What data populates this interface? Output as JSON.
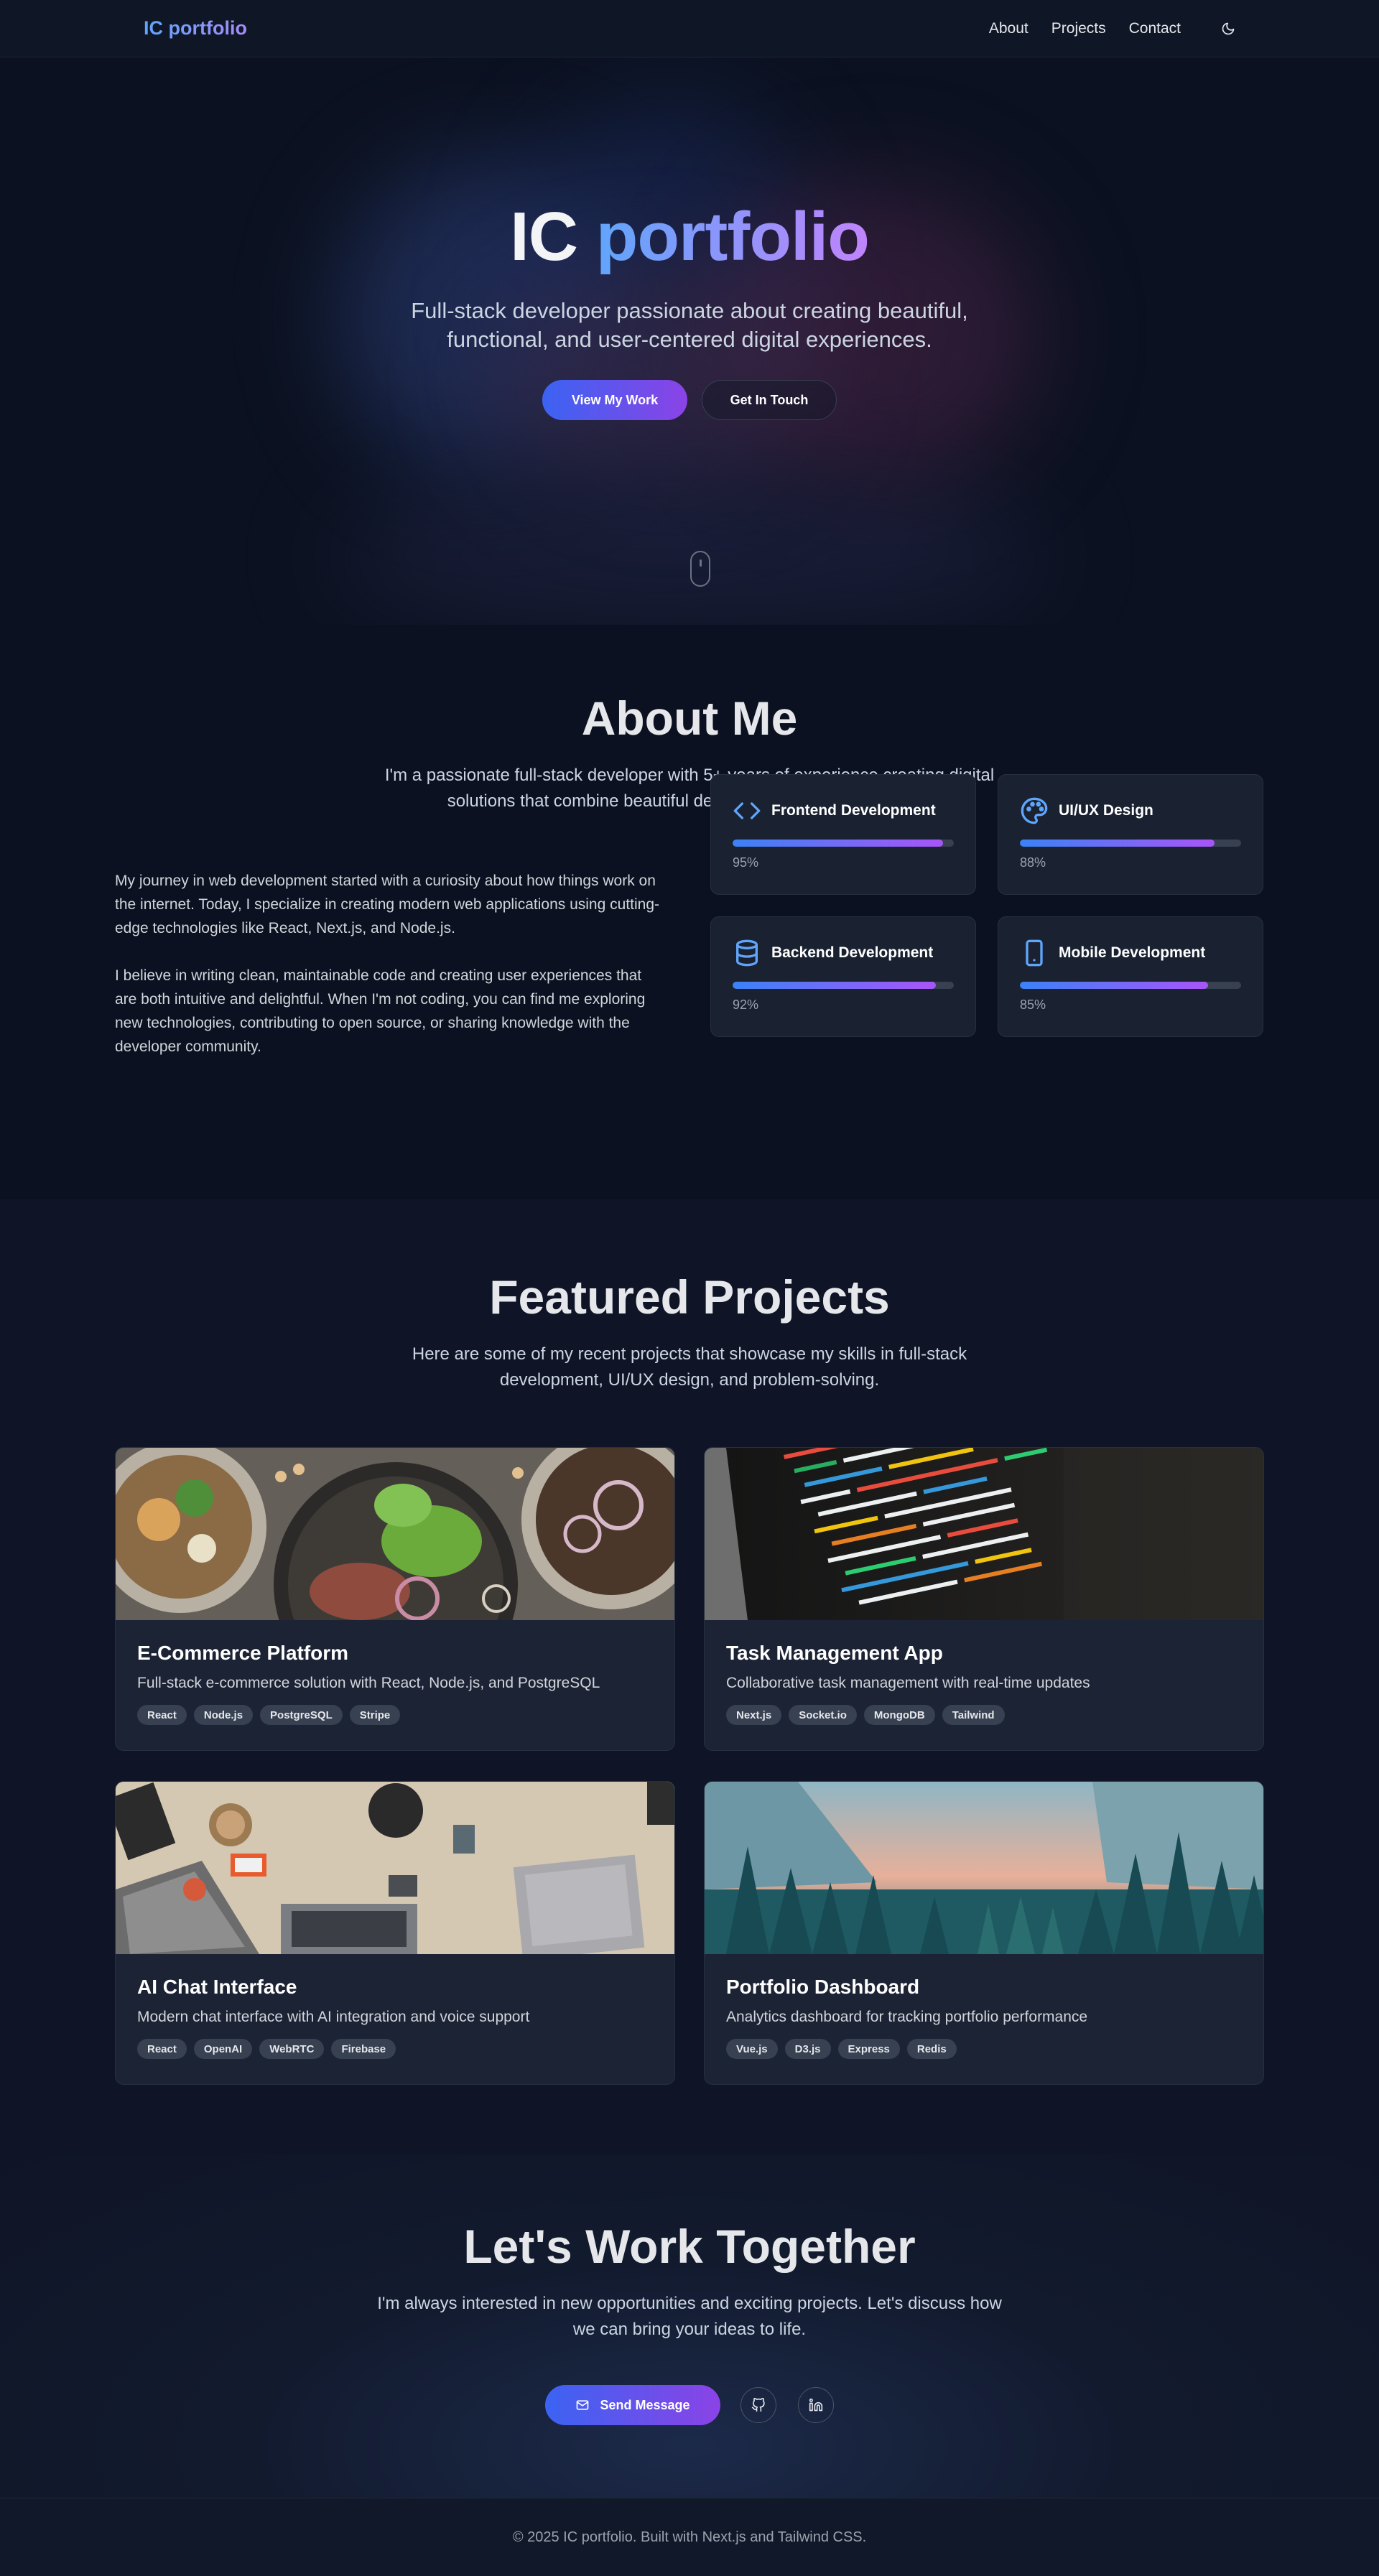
{
  "header": {
    "logo": "IC portfolio",
    "nav": [
      {
        "label": "About"
      },
      {
        "label": "Projects"
      },
      {
        "label": "Contact"
      }
    ],
    "theme_icon": "moon-icon"
  },
  "hero": {
    "title_main": "IC",
    "title_accent": "portfolio",
    "subtitle": "Full-stack developer passionate about creating beautiful, functional, and user-centered digital experiences.",
    "primary_button": "View My Work",
    "secondary_button": "Get In Touch",
    "scroll_icon": "mouse-scroll-icon"
  },
  "about": {
    "title": "About Me",
    "subtitle": "I'm a passionate full-stack developer with 5+ years of experience creating digital solutions that combine beautiful design with robust functionality.",
    "paragraphs": [
      "My journey in web development started with a curiosity about how things work on the internet. Today, I specialize in creating modern web applications using cutting-edge technologies like React, Next.js, and Node.js.",
      "I believe in writing clean, maintainable code and creating user experiences that are both intuitive and delightful. When I'm not coding, you can find me exploring new technologies, contributing to open source, or sharing knowledge with the developer community."
    ],
    "skills": [
      {
        "name": "Frontend Development",
        "icon": "code-icon",
        "level": 0.95,
        "label": "95%"
      },
      {
        "name": "UI/UX Design",
        "icon": "palette-icon",
        "level": 0.88,
        "label": "88%"
      },
      {
        "name": "Backend Development",
        "icon": "database-icon",
        "level": 0.92,
        "label": "92%"
      },
      {
        "name": "Mobile Development",
        "icon": "smartphone-icon",
        "level": 0.85,
        "label": "85%"
      }
    ]
  },
  "projects": {
    "title": "Featured Projects",
    "subtitle": "Here are some of my recent projects that showcase my skills in full-stack development, UI/UX design, and problem-solving.",
    "items": [
      {
        "title": "E-Commerce Platform",
        "desc": "Full-stack e-commerce solution with React, Node.js, and PostgreSQL",
        "tags": [
          "React",
          "Node.js",
          "PostgreSQL",
          "Stripe"
        ],
        "image": "food-bowls-image"
      },
      {
        "title": "Task Management App",
        "desc": "Collaborative task management with real-time updates",
        "tags": [
          "Next.js",
          "Socket.io",
          "MongoDB",
          "Tailwind"
        ],
        "image": "code-screen-image"
      },
      {
        "title": "AI Chat Interface",
        "desc": "Modern chat interface with AI integration and voice support",
        "tags": [
          "React",
          "OpenAI",
          "WebRTC",
          "Firebase"
        ],
        "image": "desk-laptops-image"
      },
      {
        "title": "Portfolio Dashboard",
        "desc": "Analytics dashboard for tracking portfolio performance",
        "tags": [
          "Vue.js",
          "D3.js",
          "Express",
          "Redis"
        ],
        "image": "forest-valley-image"
      }
    ]
  },
  "contact": {
    "title": "Let's Work Together",
    "subtitle": "I'm always interested in new opportunities and exciting projects. Let's discuss how we can bring your ideas to life.",
    "button": "Send Message",
    "button_icon": "mail-icon",
    "social": [
      {
        "icon": "github-icon"
      },
      {
        "icon": "linkedin-icon"
      }
    ]
  },
  "footer": {
    "text": "© 2025 IC portfolio. Built with Next.js and Tailwind CSS."
  },
  "colors": {
    "accent_start": "#3b63f2",
    "accent_end": "#8b43e6",
    "background": "#0b1120",
    "card": "#1a2232"
  }
}
